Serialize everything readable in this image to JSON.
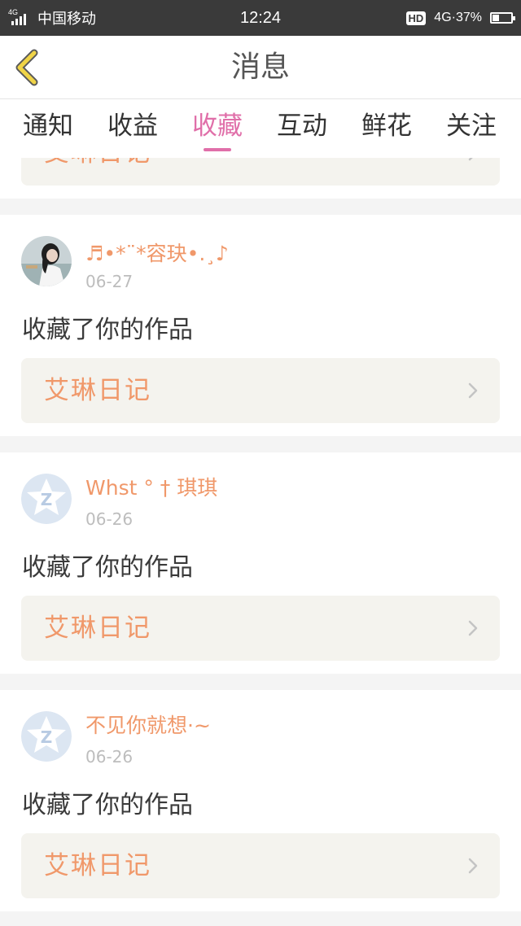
{
  "status_bar": {
    "network_tag": "4G",
    "carrier": "中国移动",
    "time": "12:24",
    "hd": "HD",
    "network": "4G·",
    "battery_pct": "37%",
    "battery_level": 0.37
  },
  "nav": {
    "title": "消息",
    "back_icon": "chevron-left-icon",
    "accent": "#f0d447"
  },
  "tabs": [
    {
      "label": "通知",
      "active": false
    },
    {
      "label": "收益",
      "active": false
    },
    {
      "label": "收藏",
      "active": true
    },
    {
      "label": "互动",
      "active": false
    },
    {
      "label": "鲜花",
      "active": false
    },
    {
      "label": "关注",
      "active": false
    }
  ],
  "colors": {
    "tab_active": "#e06fa9",
    "username": "#f0986a",
    "work_title": "#f0986a",
    "card_bg": "#f4f3ee"
  },
  "partial_card": {
    "work_title": "艾琳日记"
  },
  "notifications": [
    {
      "avatar": "photo-avatar",
      "username": "♬•*¨*容玦•.¸♪",
      "date": "06-27",
      "action": "收藏了你的作品",
      "work_title": "艾琳日记"
    },
    {
      "avatar": "default-avatar-icon",
      "username": "Whst ° † 琪琪",
      "date": "06-26",
      "action": "收藏了你的作品",
      "work_title": "艾琳日记"
    },
    {
      "avatar": "default-avatar-icon",
      "username": "不见你就想·~",
      "date": "06-26",
      "action": "收藏了你的作品",
      "work_title": "艾琳日记"
    }
  ]
}
